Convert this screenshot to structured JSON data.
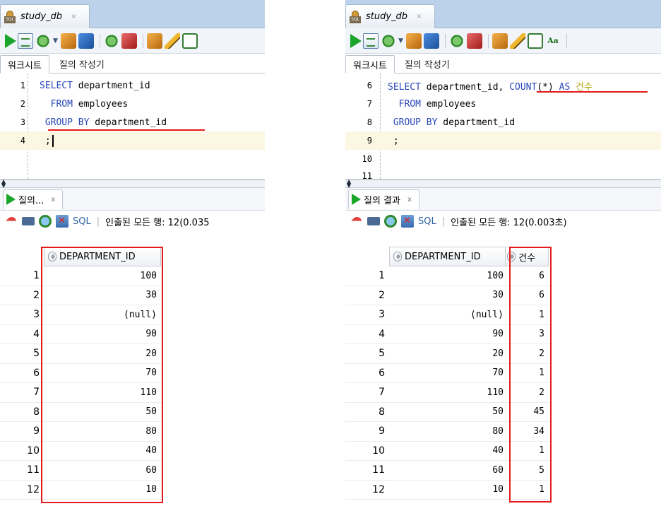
{
  "left": {
    "doc_tab": {
      "title": "study_db",
      "close": "×"
    },
    "worksheet_tabs": [
      "워크시트",
      "질의 작성기"
    ],
    "editor_lines": [
      {
        "num": "1",
        "code_kw1": "SELECT",
        "code_rest": " department_id"
      },
      {
        "num": "2",
        "code_kw1": "  FROM",
        "code_rest": " employees"
      },
      {
        "num": "3",
        "code_kw1": " GROUP BY",
        "code_rest": " department_id"
      },
      {
        "num": "4",
        "code_kw1": "",
        "code_rest": " ;"
      }
    ],
    "result_tab": {
      "label": "질의...",
      "close": "x"
    },
    "result_toolbar": {
      "sql": "SQL",
      "separator": "|",
      "fetched": "인출된 모든 행: 12(0.035"
    },
    "columns": [
      "DEPARTMENT_ID"
    ],
    "rows": [
      {
        "n": "1",
        "dept": "100"
      },
      {
        "n": "2",
        "dept": "30"
      },
      {
        "n": "3",
        "dept": "(null)"
      },
      {
        "n": "4",
        "dept": "90"
      },
      {
        "n": "5",
        "dept": "20"
      },
      {
        "n": "6",
        "dept": "70"
      },
      {
        "n": "7",
        "dept": "110"
      },
      {
        "n": "8",
        "dept": "50"
      },
      {
        "n": "9",
        "dept": "80"
      },
      {
        "n": "10",
        "dept": "40"
      },
      {
        "n": "11",
        "dept": "60"
      },
      {
        "n": "12",
        "dept": "10"
      }
    ]
  },
  "right": {
    "doc_tab": {
      "title": "study_db",
      "close": "×"
    },
    "worksheet_tabs": [
      "워크시트",
      "질의 작성기"
    ],
    "editor_lines": [
      {
        "num": "6",
        "kw": "SELECT",
        "a": " department_id, ",
        "fn": "COUNT",
        "b": "(*) ",
        "kw2": "AS",
        "ko": " 건수"
      },
      {
        "num": "7",
        "kw": "  FROM",
        "a": " employees"
      },
      {
        "num": "8",
        "kw": " GROUP BY",
        "a": " department_id"
      },
      {
        "num": "9",
        "kw": "",
        "a": " ;"
      },
      {
        "num": "10",
        "kw": "",
        "a": ""
      },
      {
        "num": "11",
        "kw": "",
        "a": ""
      }
    ],
    "result_tab": {
      "label": "질의 결과",
      "close": "x"
    },
    "result_toolbar": {
      "sql": "SQL",
      "separator": "|",
      "fetched": "인출된 모든 행: 12(0.003초)"
    },
    "columns": [
      "DEPARTMENT_ID",
      "건수"
    ],
    "rows": [
      {
        "n": "1",
        "dept": "100",
        "cnt": "6"
      },
      {
        "n": "2",
        "dept": "30",
        "cnt": "6"
      },
      {
        "n": "3",
        "dept": "(null)",
        "cnt": "1"
      },
      {
        "n": "4",
        "dept": "90",
        "cnt": "3"
      },
      {
        "n": "5",
        "dept": "20",
        "cnt": "2"
      },
      {
        "n": "6",
        "dept": "70",
        "cnt": "1"
      },
      {
        "n": "7",
        "dept": "110",
        "cnt": "2"
      },
      {
        "n": "8",
        "dept": "50",
        "cnt": "45"
      },
      {
        "n": "9",
        "dept": "80",
        "cnt": "34"
      },
      {
        "n": "10",
        "dept": "40",
        "cnt": "1"
      },
      {
        "n": "11",
        "dept": "60",
        "cnt": "5"
      },
      {
        "n": "12",
        "dept": "10",
        "cnt": "1"
      }
    ]
  },
  "colors": {
    "highlight": "#e41a1a",
    "keyword": "#2a47b8",
    "korean_alias": "#a9a300",
    "run": "#1aa52b"
  }
}
